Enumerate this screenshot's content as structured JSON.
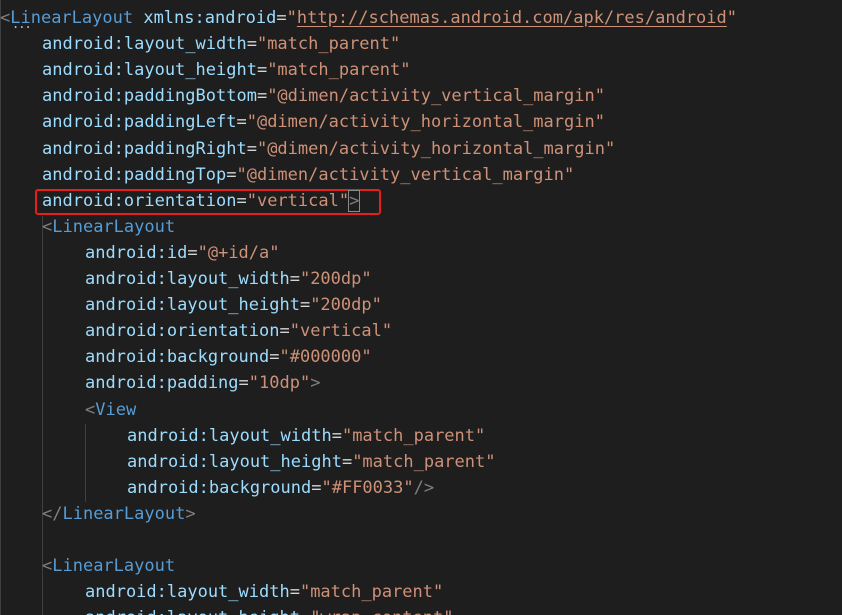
{
  "editor": {
    "lines": [
      {
        "indent": 0,
        "parts": [
          {
            "c": "t-punc",
            "t": "<"
          },
          {
            "c": "t-tag",
            "t": "LinearLayout"
          },
          {
            "c": "t-eq",
            "t": " "
          },
          {
            "c": "t-attr",
            "t": "xmlns:android"
          },
          {
            "c": "t-eq",
            "t": "="
          },
          {
            "c": "t-str",
            "t": "\""
          },
          {
            "c": "t-url",
            "t": "http://schemas.android.com/apk/res/android"
          },
          {
            "c": "t-str",
            "t": "\""
          }
        ]
      },
      {
        "indent": 1,
        "parts": [
          {
            "c": "t-attr",
            "t": "android:layout_width"
          },
          {
            "c": "t-eq",
            "t": "="
          },
          {
            "c": "t-str",
            "t": "\"match_parent\""
          }
        ]
      },
      {
        "indent": 1,
        "parts": [
          {
            "c": "t-attr",
            "t": "android:layout_height"
          },
          {
            "c": "t-eq",
            "t": "="
          },
          {
            "c": "t-str",
            "t": "\"match_parent\""
          }
        ]
      },
      {
        "indent": 1,
        "parts": [
          {
            "c": "t-attr",
            "t": "android:paddingBottom"
          },
          {
            "c": "t-eq",
            "t": "="
          },
          {
            "c": "t-str",
            "t": "\"@dimen/activity_vertical_margin\""
          }
        ]
      },
      {
        "indent": 1,
        "parts": [
          {
            "c": "t-attr",
            "t": "android:paddingLeft"
          },
          {
            "c": "t-eq",
            "t": "="
          },
          {
            "c": "t-str",
            "t": "\"@dimen/activity_horizontal_margin\""
          }
        ]
      },
      {
        "indent": 1,
        "parts": [
          {
            "c": "t-attr",
            "t": "android:paddingRight"
          },
          {
            "c": "t-eq",
            "t": "="
          },
          {
            "c": "t-str",
            "t": "\"@dimen/activity_horizontal_margin\""
          }
        ]
      },
      {
        "indent": 1,
        "parts": [
          {
            "c": "t-attr",
            "t": "android:paddingTop"
          },
          {
            "c": "t-eq",
            "t": "="
          },
          {
            "c": "t-str",
            "t": "\"@dimen/activity_vertical_margin\""
          }
        ]
      },
      {
        "indent": 1,
        "parts": [
          {
            "c": "t-attr",
            "t": "android:orientation"
          },
          {
            "c": "t-eq",
            "t": "="
          },
          {
            "c": "t-str",
            "t": "\"vertical\""
          },
          {
            "c": "t-punc cursor-bracket",
            "t": ">"
          }
        ]
      },
      {
        "indent": 1,
        "parts": [
          {
            "c": "t-punc",
            "t": "<"
          },
          {
            "c": "t-tag",
            "t": "LinearLayout"
          }
        ]
      },
      {
        "indent": 2,
        "parts": [
          {
            "c": "t-attr",
            "t": "android:id"
          },
          {
            "c": "t-eq",
            "t": "="
          },
          {
            "c": "t-str",
            "t": "\"@+id/a\""
          }
        ]
      },
      {
        "indent": 2,
        "parts": [
          {
            "c": "t-attr",
            "t": "android:layout_width"
          },
          {
            "c": "t-eq",
            "t": "="
          },
          {
            "c": "t-str",
            "t": "\"200dp\""
          }
        ]
      },
      {
        "indent": 2,
        "parts": [
          {
            "c": "t-attr",
            "t": "android:layout_height"
          },
          {
            "c": "t-eq",
            "t": "="
          },
          {
            "c": "t-str",
            "t": "\"200dp\""
          }
        ]
      },
      {
        "indent": 2,
        "parts": [
          {
            "c": "t-attr",
            "t": "android:orientation"
          },
          {
            "c": "t-eq",
            "t": "="
          },
          {
            "c": "t-str",
            "t": "\"vertical\""
          }
        ]
      },
      {
        "indent": 2,
        "parts": [
          {
            "c": "t-attr",
            "t": "android:background"
          },
          {
            "c": "t-eq",
            "t": "="
          },
          {
            "c": "t-str",
            "t": "\"#000000\""
          }
        ]
      },
      {
        "indent": 2,
        "parts": [
          {
            "c": "t-attr",
            "t": "android:padding"
          },
          {
            "c": "t-eq",
            "t": "="
          },
          {
            "c": "t-str",
            "t": "\"10dp\""
          },
          {
            "c": "t-punc",
            "t": ">"
          }
        ]
      },
      {
        "indent": 2,
        "parts": [
          {
            "c": "t-punc",
            "t": "<"
          },
          {
            "c": "t-tag",
            "t": "View"
          }
        ]
      },
      {
        "indent": 3,
        "parts": [
          {
            "c": "t-attr",
            "t": "android:layout_width"
          },
          {
            "c": "t-eq",
            "t": "="
          },
          {
            "c": "t-str",
            "t": "\"match_parent\""
          }
        ]
      },
      {
        "indent": 3,
        "parts": [
          {
            "c": "t-attr",
            "t": "android:layout_height"
          },
          {
            "c": "t-eq",
            "t": "="
          },
          {
            "c": "t-str",
            "t": "\"match_parent\""
          }
        ]
      },
      {
        "indent": 3,
        "parts": [
          {
            "c": "t-attr",
            "t": "android:background"
          },
          {
            "c": "t-eq",
            "t": "="
          },
          {
            "c": "t-str",
            "t": "\"#FF0033\""
          },
          {
            "c": "t-punc",
            "t": "/>"
          }
        ]
      },
      {
        "indent": 1,
        "parts": [
          {
            "c": "t-punc",
            "t": "</"
          },
          {
            "c": "t-tag",
            "t": "LinearLayout"
          },
          {
            "c": "t-punc",
            "t": ">"
          }
        ]
      },
      {
        "indent": 0,
        "parts": []
      },
      {
        "indent": 1,
        "parts": [
          {
            "c": "t-punc",
            "t": "<"
          },
          {
            "c": "t-tag",
            "t": "LinearLayout"
          }
        ]
      },
      {
        "indent": 2,
        "parts": [
          {
            "c": "t-attr",
            "t": "android:layout_width"
          },
          {
            "c": "t-eq",
            "t": "="
          },
          {
            "c": "t-str",
            "t": "\"match_parent\""
          }
        ]
      },
      {
        "indent": 2,
        "parts": [
          {
            "c": "t-attr",
            "t": "android:layout_height"
          },
          {
            "c": "t-eq",
            "t": "="
          },
          {
            "c": "t-str",
            "t": "\"wrap_content\""
          }
        ]
      }
    ],
    "fold_marker": "...",
    "highlighted_line_index": 7,
    "highlight_color": "#e61e1e"
  }
}
